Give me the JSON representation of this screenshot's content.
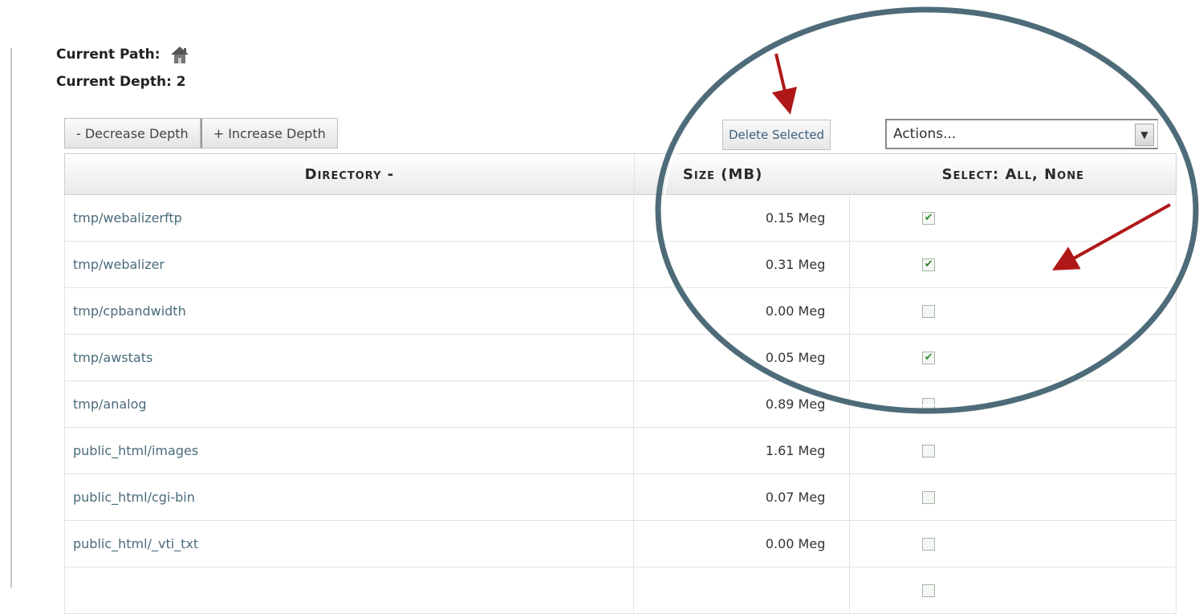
{
  "header": {
    "current_path_label": "Current Path:",
    "current_depth_label": "Current Depth: 2"
  },
  "toolbar": {
    "decrease_label": "- Decrease Depth",
    "increase_label": "+ Increase Depth",
    "delete_label": "Delete Selected",
    "actions_value": "Actions..."
  },
  "table": {
    "headers": {
      "directory": "Directory -",
      "size": "Size (MB)",
      "select": "Select: All, None"
    },
    "rows": [
      {
        "dir": "tmp/webalizerftp",
        "size": "0.15 Meg",
        "checked": true
      },
      {
        "dir": "tmp/webalizer",
        "size": "0.31 Meg",
        "checked": true
      },
      {
        "dir": "tmp/cpbandwidth",
        "size": "0.00 Meg",
        "checked": false
      },
      {
        "dir": "tmp/awstats",
        "size": "0.05 Meg",
        "checked": true
      },
      {
        "dir": "tmp/analog",
        "size": "0.89 Meg",
        "checked": false
      },
      {
        "dir": "public_html/images",
        "size": "1.61 Meg",
        "checked": false
      },
      {
        "dir": "public_html/cgi-bin",
        "size": "0.07 Meg",
        "checked": false
      },
      {
        "dir": "public_html/_vti_txt",
        "size": "0.00 Meg",
        "checked": false
      },
      {
        "dir": "",
        "size": "",
        "checked": false
      }
    ]
  },
  "annotation_colors": {
    "circle": "#4e6b79",
    "arrows": "#b01818"
  }
}
